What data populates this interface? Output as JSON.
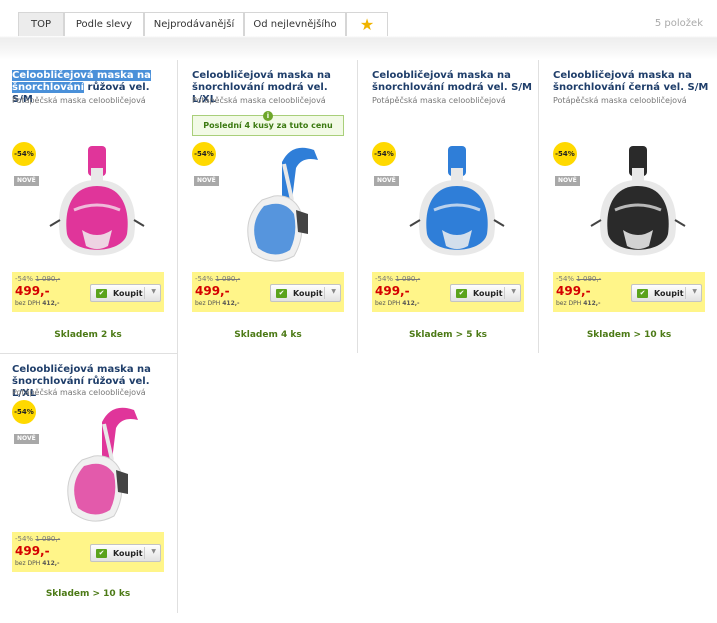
{
  "tabs": [
    {
      "label": "TOP",
      "active": true
    },
    {
      "label": "Podle slevy",
      "active": false
    },
    {
      "label": "Nejprodávanější",
      "active": false
    },
    {
      "label": "Od nejlevnějšího",
      "active": false
    }
  ],
  "favorite_tab_icon": "star-icon",
  "result_count": "5 položek",
  "products": [
    {
      "title_highlighted": "Celoobličejová maska na šnorchlování",
      "title": " růžová vel. S/M",
      "category": "Potápěčská maska celoobličejová",
      "discount": "-54%",
      "badge": "NOVÉ",
      "old_price_pct": "-54%",
      "old_price": "1 090,-",
      "price": "499,-",
      "ex_vat_label": "bez DPH",
      "ex_vat_price": "412,-",
      "buy_label": "Koupit",
      "stock": "Skladem 2 ks",
      "mask_color": "#e0359a",
      "mask_style": "front"
    },
    {
      "title": "Celoobličejová maska na šnorchlování modrá vel. L/XL",
      "category": "Potápěčská maska celoobličejová",
      "notice": "Poslední 4 kusy za tuto cenu",
      "discount": "-54%",
      "badge": "NOVÉ",
      "old_price_pct": "-54%",
      "old_price": "1 090,-",
      "price": "499,-",
      "ex_vat_label": "bez DPH",
      "ex_vat_price": "412,-",
      "buy_label": "Koupit",
      "stock": "Skladem 4 ks",
      "mask_color": "#2f7ed8",
      "mask_style": "side"
    },
    {
      "title": "Celoobličejová maska na šnorchlování modrá vel. S/M",
      "category": "Potápěčská maska celoobličejová",
      "discount": "-54%",
      "badge": "NOVÉ",
      "old_price_pct": "-54%",
      "old_price": "1 090,-",
      "price": "499,-",
      "ex_vat_label": "bez DPH",
      "ex_vat_price": "412,-",
      "buy_label": "Koupit",
      "stock": "Skladem > 5 ks",
      "mask_color": "#2f7ed8",
      "mask_style": "front"
    },
    {
      "title": "Celoobličejová maska na šnorchlování černá vel. S/M",
      "category": "Potápěčská maska celoobličejová",
      "discount": "-54%",
      "badge": "NOVÉ",
      "old_price_pct": "-54%",
      "old_price": "1 090,-",
      "price": "499,-",
      "ex_vat_label": "bez DPH",
      "ex_vat_price": "412,-",
      "buy_label": "Koupit",
      "stock": "Skladem > 10 ks",
      "mask_color": "#2a2a2a",
      "mask_style": "front"
    },
    {
      "title": "Celoobličejová maska na šnorchlování růžová vel. L/XL",
      "category": "Potápěčská maska celoobličejová",
      "discount": "-54%",
      "badge": "NOVÉ",
      "old_price_pct": "-54%",
      "old_price": "1 090,-",
      "price": "499,-",
      "ex_vat_label": "bez DPH",
      "ex_vat_price": "412,-",
      "buy_label": "Koupit",
      "stock": "Skladem > 10 ks",
      "mask_color": "#e0359a",
      "mask_style": "side"
    }
  ],
  "colors": {
    "price": "#d40000",
    "price_box": "#fff589",
    "discount_badge": "#ffd900",
    "stock": "#4c7a16",
    "title": "#1f3e6a"
  }
}
